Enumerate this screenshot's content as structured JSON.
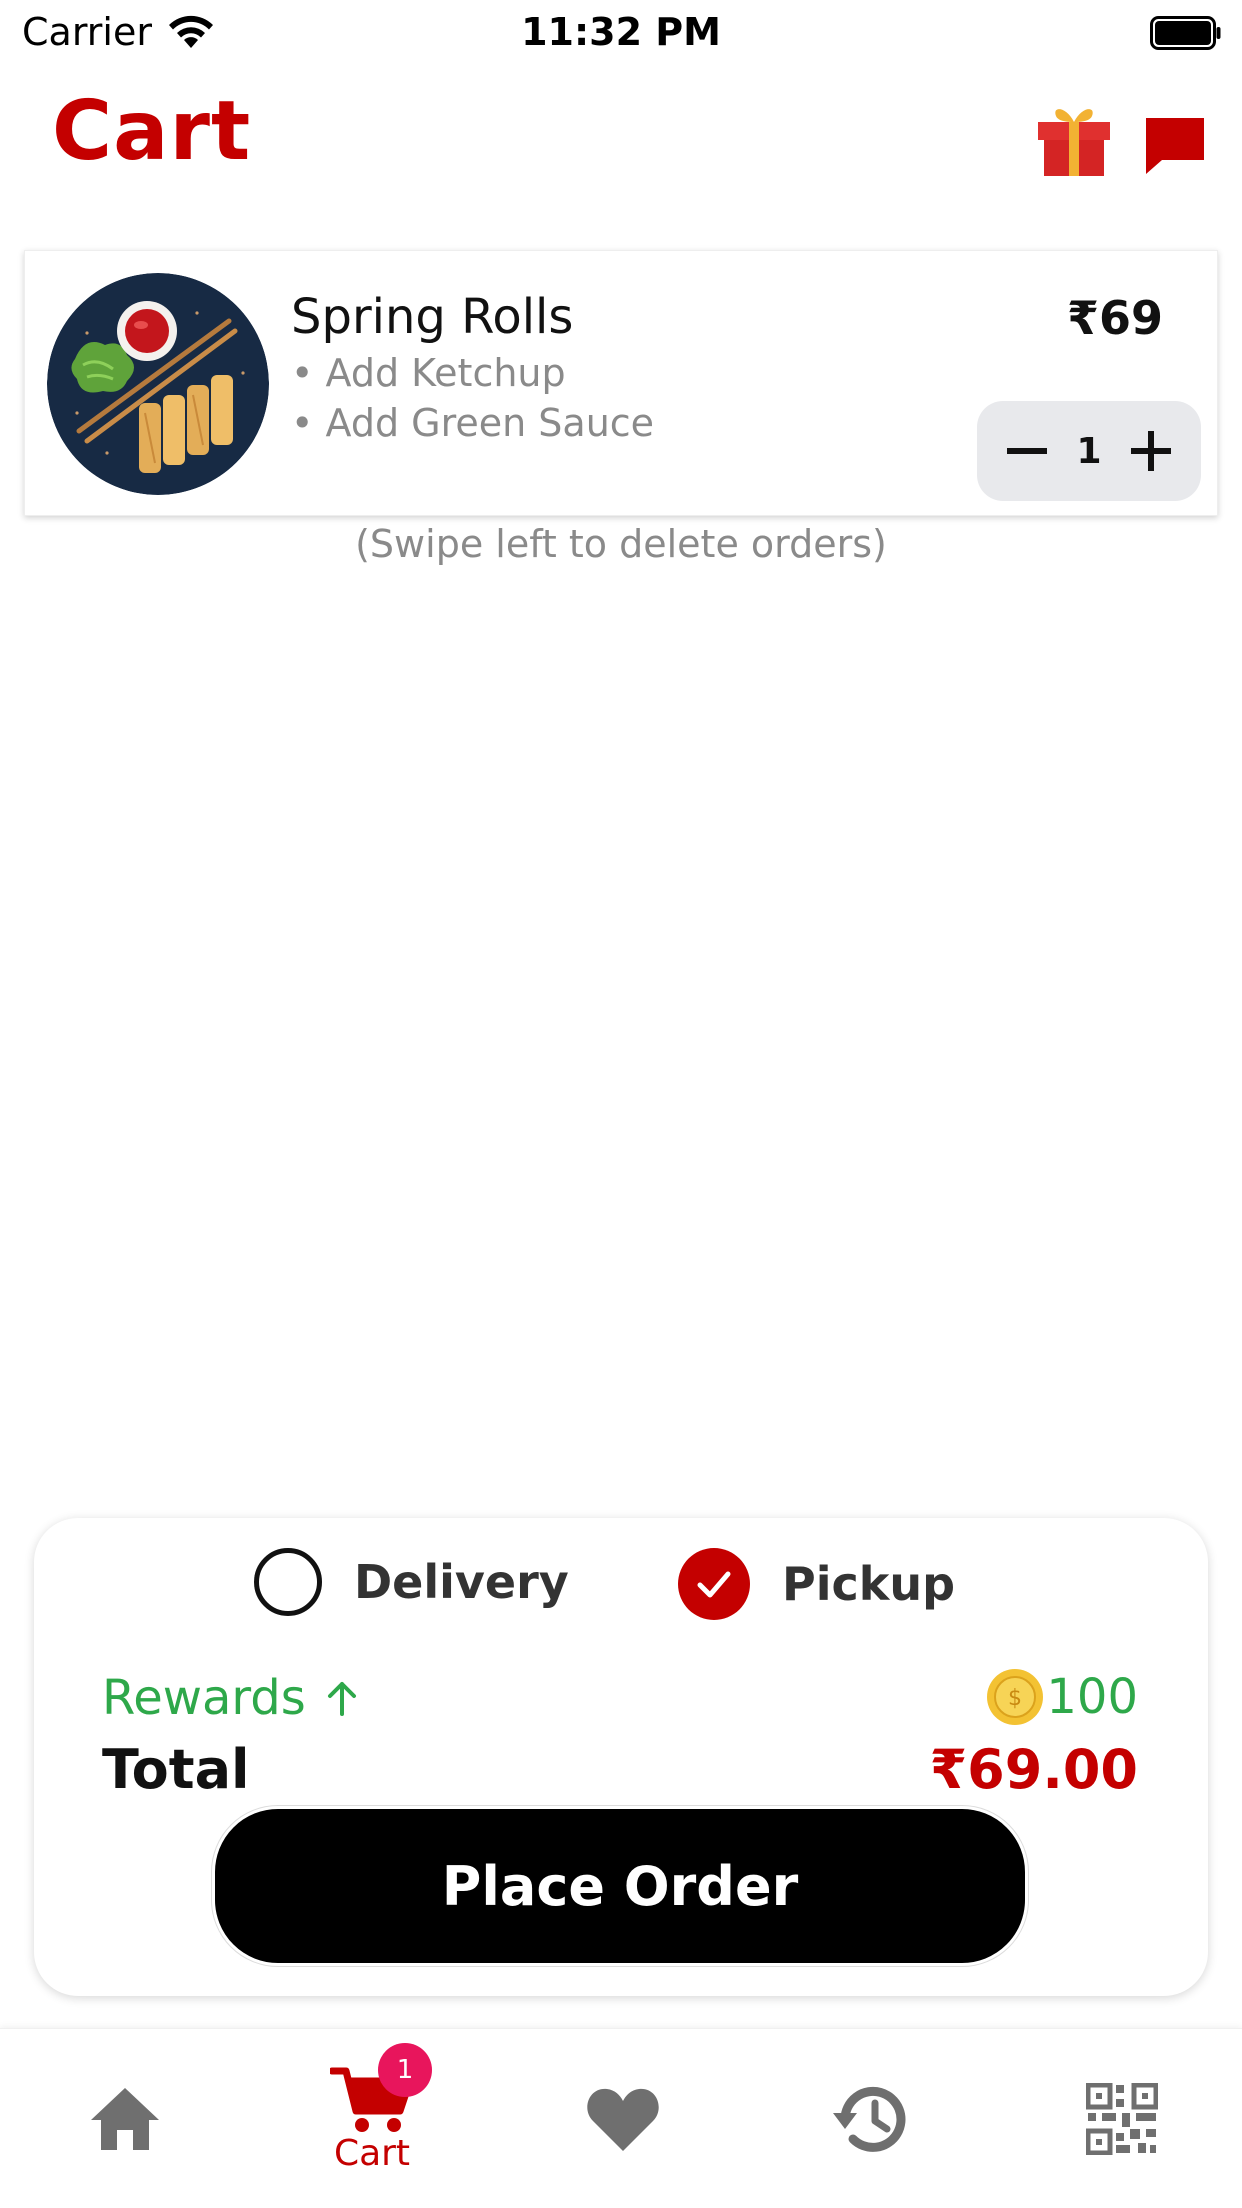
{
  "status_bar": {
    "carrier": "Carrier",
    "time": "11:32 PM"
  },
  "header": {
    "title": "Cart",
    "icons": [
      "gift-icon",
      "chat-icon"
    ]
  },
  "cart_items": [
    {
      "name": "Spring Rolls",
      "addons": [
        "• Add Ketchup",
        "• Add Green Sauce"
      ],
      "price": "₹69",
      "quantity": "1"
    }
  ],
  "swipe_hint": "(Swipe left to delete orders)",
  "order_options": {
    "delivery_label": "Delivery",
    "pickup_label": "Pickup",
    "selected": "Pickup"
  },
  "summary": {
    "rewards_label": "Rewards",
    "rewards_value": "100",
    "total_label": "Total",
    "total_value": "₹69.00",
    "place_order_label": "Place Order"
  },
  "tab_bar": {
    "active": "Cart",
    "cart_label": "Cart",
    "cart_badge": "1",
    "icons": [
      "home-icon",
      "cart-icon",
      "heart-icon",
      "history-icon",
      "qr-code-icon"
    ]
  },
  "colors": {
    "brand_red": "#c40000",
    "rewards_green": "#2ea84a",
    "badge_pink": "#e8155c",
    "stepper_bg": "#e8e9ec"
  }
}
